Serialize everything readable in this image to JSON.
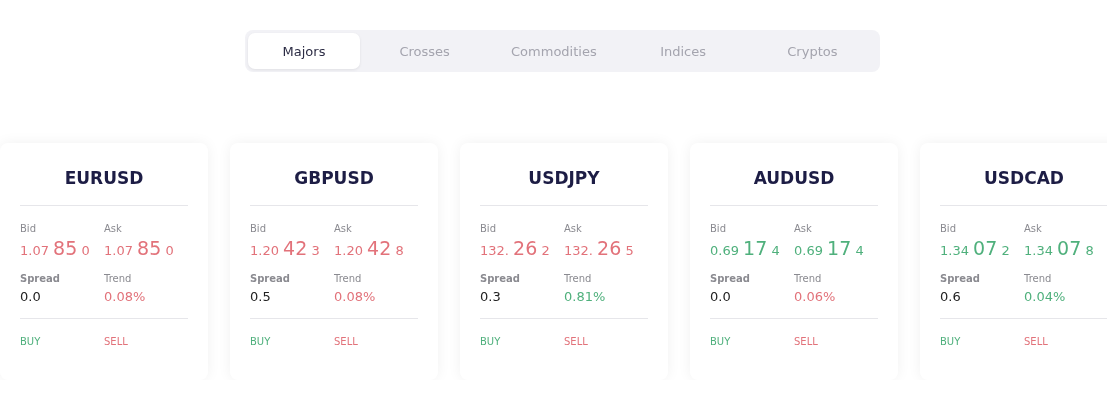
{
  "tabs": [
    {
      "label": "Majors",
      "selected": true
    },
    {
      "label": "Crosses",
      "selected": false
    },
    {
      "label": "Commodities",
      "selected": false
    },
    {
      "label": "Indices",
      "selected": false
    },
    {
      "label": "Cryptos",
      "selected": false
    }
  ],
  "cards": [
    {
      "symbol": "EURUSD",
      "bid_label": "Bid",
      "ask_label": "Ask",
      "bid": {
        "lead": "1.07",
        "pips": "85",
        "tail": "0",
        "color": "#e2727a"
      },
      "ask": {
        "lead": "1.07",
        "pips": "85",
        "tail": "0",
        "color": "#e2727a"
      },
      "spread_label": "Spread",
      "spread": "0.0",
      "trend_label": "Trend",
      "trend": {
        "text": "0.08%",
        "color": "#e2727a"
      },
      "buy": "BUY",
      "sell": "SELL"
    },
    {
      "symbol": "GBPUSD",
      "bid_label": "Bid",
      "ask_label": "Ask",
      "bid": {
        "lead": "1.20",
        "pips": "42",
        "tail": "3",
        "color": "#e2727a"
      },
      "ask": {
        "lead": "1.20",
        "pips": "42",
        "tail": "8",
        "color": "#e2727a"
      },
      "spread_label": "Spread",
      "spread": "0.5",
      "trend_label": "Trend",
      "trend": {
        "text": "0.08%",
        "color": "#e2727a"
      },
      "buy": "BUY",
      "sell": "SELL"
    },
    {
      "symbol": "USDJPY",
      "bid_label": "Bid",
      "ask_label": "Ask",
      "bid": {
        "lead": "132.",
        "pips": "26",
        "tail": "2",
        "color": "#e2727a"
      },
      "ask": {
        "lead": "132.",
        "pips": "26",
        "tail": "5",
        "color": "#e2727a"
      },
      "spread_label": "Spread",
      "spread": "0.3",
      "trend_label": "Trend",
      "trend": {
        "text": "0.81%",
        "color": "#4fb07c"
      },
      "buy": "BUY",
      "sell": "SELL"
    },
    {
      "symbol": "AUDUSD",
      "bid_label": "Bid",
      "ask_label": "Ask",
      "bid": {
        "lead": "0.69",
        "pips": "17",
        "tail": "4",
        "color": "#4fb07c"
      },
      "ask": {
        "lead": "0.69",
        "pips": "17",
        "tail": "4",
        "color": "#4fb07c"
      },
      "spread_label": "Spread",
      "spread": "0.0",
      "trend_label": "Trend",
      "trend": {
        "text": "0.06%",
        "color": "#e2727a"
      },
      "buy": "BUY",
      "sell": "SELL"
    },
    {
      "symbol": "USDCAD",
      "bid_label": "Bid",
      "ask_label": "Ask",
      "bid": {
        "lead": "1.34",
        "pips": "07",
        "tail": "2",
        "color": "#4fb07c"
      },
      "ask": {
        "lead": "1.34",
        "pips": "07",
        "tail": "8",
        "color": "#4fb07c"
      },
      "spread_label": "Spread",
      "spread": "0.6",
      "trend_label": "Trend",
      "trend": {
        "text": "0.04%",
        "color": "#4fb07c"
      },
      "buy": "BUY",
      "sell": "SELL"
    }
  ]
}
